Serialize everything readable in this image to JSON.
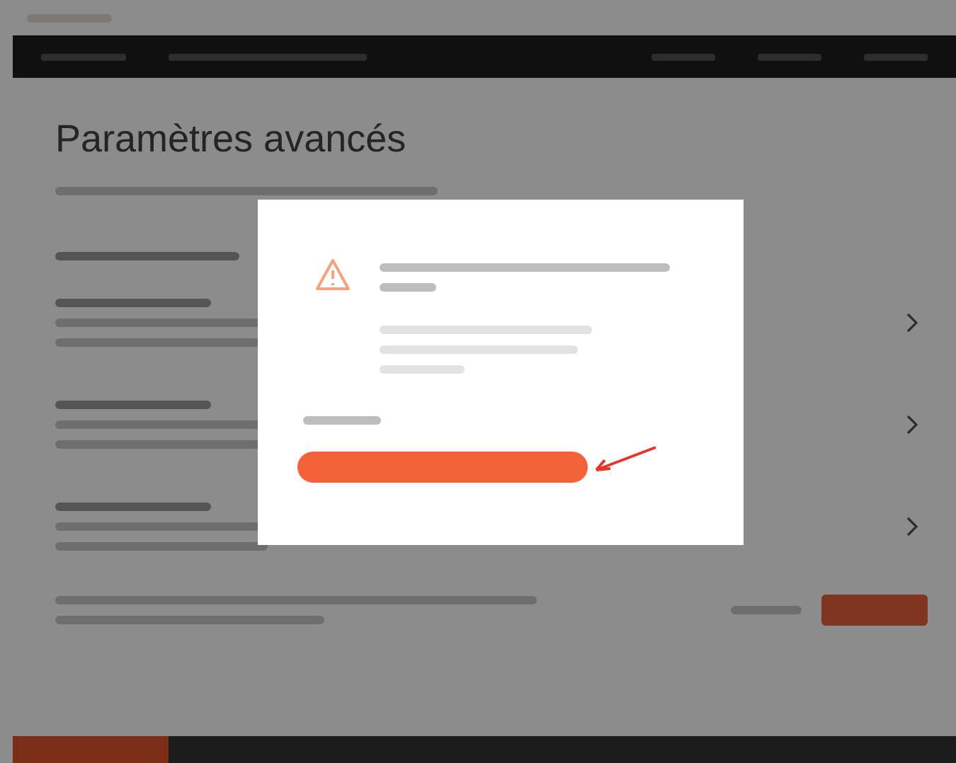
{
  "page": {
    "title": "Paramètres avancés"
  }
}
